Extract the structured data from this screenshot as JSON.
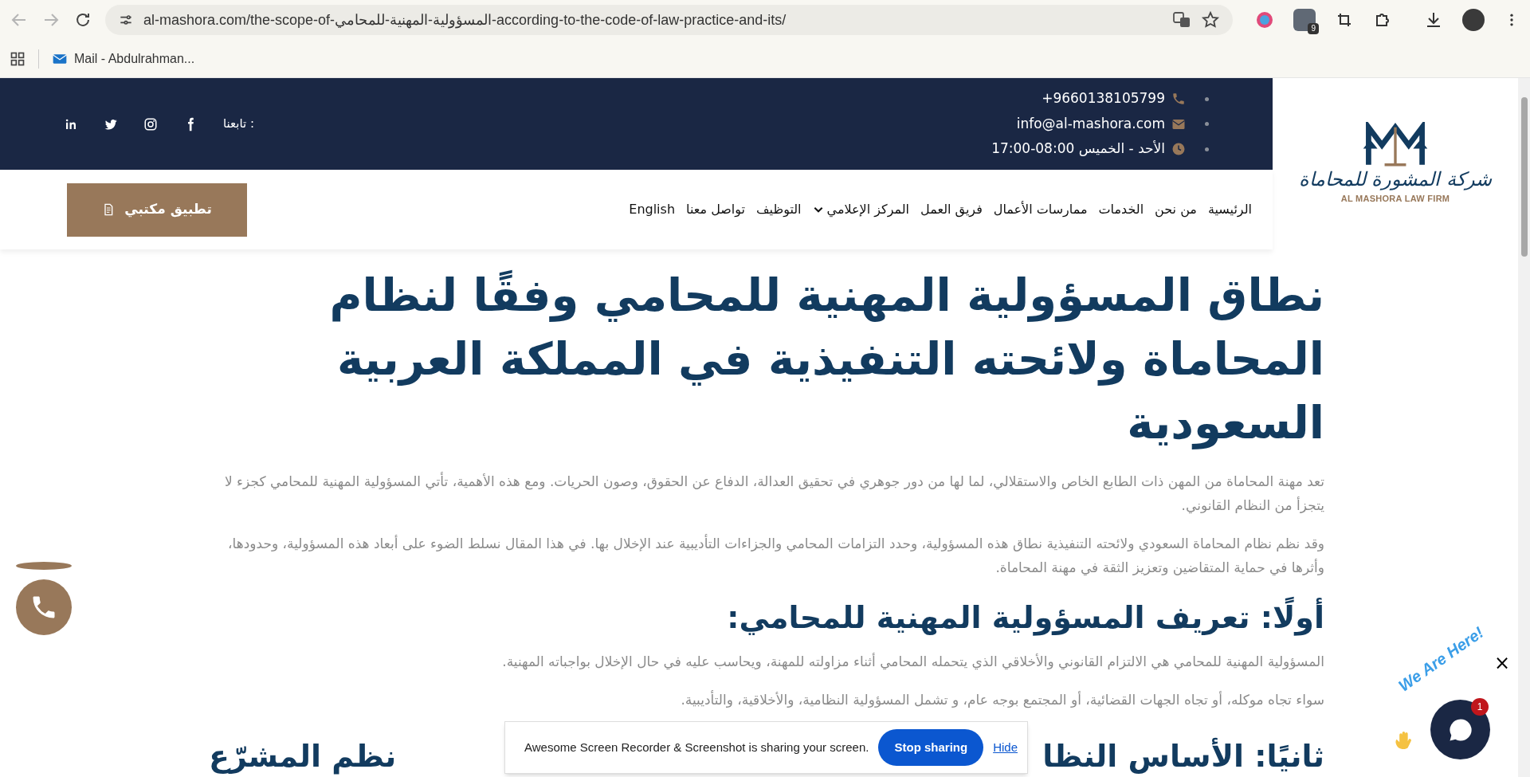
{
  "browser": {
    "url": "al-mashora.com/the-scope-of-المسؤولية-المهنية-للمحامي-according-to-the-code-of-law-practice-and-its/",
    "extension_badge": "9",
    "bookmarks": [
      {
        "label": "Mail - Abdulrahman..."
      }
    ]
  },
  "top_bar": {
    "contacts": [
      {
        "kind": "phone",
        "text": "+9660138105799"
      },
      {
        "kind": "email",
        "text": "info@al-mashora.com"
      },
      {
        "kind": "hours",
        "text": "الأحد - الخميس 08:00-17:00"
      }
    ],
    "follow_label": "تابعنا :",
    "socials": [
      {
        "kind": "facebook"
      },
      {
        "kind": "instagram"
      },
      {
        "kind": "twitter"
      },
      {
        "kind": "linkedin"
      }
    ]
  },
  "logo": {
    "arabic": "شركة المشورة للمحاماة",
    "english": "AL MASHORA LAW FIRM"
  },
  "nav": {
    "items": [
      {
        "label": "الرئيسية",
        "dropdown": false
      },
      {
        "label": "من نحن",
        "dropdown": false
      },
      {
        "label": "الخدمات",
        "dropdown": false
      },
      {
        "label": "ممارسات الأعمال",
        "dropdown": false
      },
      {
        "label": "فريق العمل",
        "dropdown": false
      },
      {
        "label": "المركز الإعلامي",
        "dropdown": true
      },
      {
        "label": "التوظيف",
        "dropdown": false
      },
      {
        "label": "تواصل معنا",
        "dropdown": false
      },
      {
        "label": "English",
        "dropdown": false
      }
    ],
    "button": "تطبيق مكتبي"
  },
  "article": {
    "title": "نطاق المسؤولية المهنية للمحامي وفقًا لنظام المحاماة ولائحته التنفيذية في المملكة العربية السعودية",
    "blocks": [
      {
        "kind": "paragraph",
        "text": "تعد مهنة المحاماة من المهن ذات الطابع الخاص والاستقلالي، لما لها من دور جوهري في تحقيق العدالة، الدفاع عن الحقوق، وصون الحريات. ومع هذه الأهمية، تأتي المسؤولية المهنية للمحامي كجزء لا يتجزأ من النظام القانوني."
      },
      {
        "kind": "paragraph",
        "text": "وقد نظم نظام المحاماة السعودي ولائحته التنفيذية نطاق هذه المسؤولية، وحدد التزامات المحامي والجزاءات التأديبية عند الإخلال بها. في هذا المقال نسلط الضوء على أبعاد هذه المسؤولية، وحدودها، وأثرها في حماية المتقاضين وتعزيز الثقة في مهنة المحاماة."
      },
      {
        "kind": "heading",
        "text": "أولًا: تعريف المسؤولية المهنية للمحامي:"
      },
      {
        "kind": "paragraph",
        "text": "المسؤولية المهنية للمحامي هي الالتزام القانوني والأخلاقي الذي يتحمله المحامي أثناء مزاولته للمهنة، ويحاسب عليه في حال الإخلال بواجباته المهنية."
      },
      {
        "kind": "paragraph",
        "text": "سواء تجاه موكله، أو تجاه الجهات القضائية، أو المجتمع بوجه عام، و تشمل المسؤولية النظامية، والأخلاقية، والتأديبية."
      },
      {
        "kind": "split_heading",
        "parts": [
          "ثانيًا: الأساس النظا",
          "نظم المشرّع"
        ]
      }
    ]
  },
  "chat_widget": {
    "close": "×",
    "tagline": "We Are Here!",
    "badge": "1"
  },
  "share_bar": {
    "message": "Awesome Screen Recorder & Screenshot is sharing your screen.",
    "stop": "Stop sharing",
    "hide": "Hide"
  }
}
